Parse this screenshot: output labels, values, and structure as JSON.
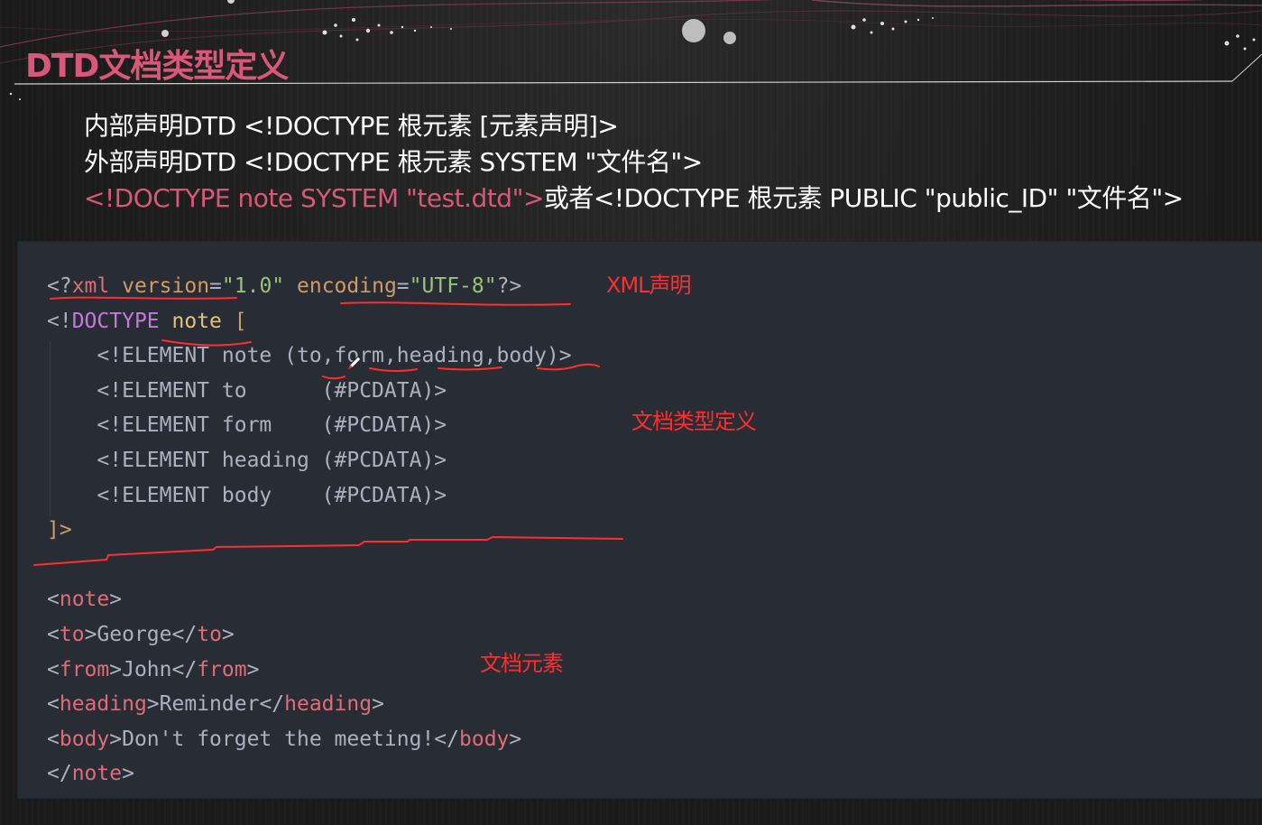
{
  "slide": {
    "title": "DTD文档类型定义"
  },
  "syntax": {
    "internal": "内部声明DTD  <!DOCTYPE 根元素 [元素声明]>",
    "external": "外部声明DTD  <!DOCTYPE 根元素 SYSTEM \"文件名\">",
    "example_pink": "<!DOCTYPE note SYSTEM \"test.dtd\">",
    "or_text": "或者<!DOCTYPE 根元素 PUBLIC \"public_ID\" \"文件名\">"
  },
  "code": {
    "xml_decl": {
      "open": "<?",
      "xml": "xml",
      "version_attr": "version",
      "eq": "=",
      "version_val": "\"1.0\"",
      "encoding_attr": "encoding",
      "encoding_val": "\"UTF-8\"",
      "close": "?>"
    },
    "doctype": {
      "open": "<!",
      "keyword": "DOCTYPE",
      "name": "note",
      "bracket": "["
    },
    "elements": [
      {
        "decl": "<!ELEMENT",
        "name": "note",
        "pad": "    ",
        "content": "(to,form,heading,body)>"
      },
      {
        "decl": "<!ELEMENT",
        "name": "to",
        "pad": "      ",
        "content": "(#PCDATA)>"
      },
      {
        "decl": "<!ELEMENT",
        "name": "form",
        "pad": "    ",
        "content": "(#PCDATA)>"
      },
      {
        "decl": "<!ELEMENT",
        "name": "heading",
        "pad": " ",
        "content": "(#PCDATA)>"
      },
      {
        "decl": "<!ELEMENT",
        "name": "body",
        "pad": "    ",
        "content": "(#PCDATA)>"
      }
    ],
    "doctype_close": "]>",
    "doc": {
      "note": "note",
      "to_tag": "to",
      "to_text": "George",
      "from_tag": "from",
      "from_text": "John",
      "heading_tag": "heading",
      "heading_text": "Reminder",
      "body_tag": "body",
      "body_text": "Don't forget the meeting!"
    }
  },
  "annotations": {
    "xml_decl": "XML声明",
    "dtd": "文档类型定义",
    "elements": "文档元素",
    "color": "#ff2e2e"
  },
  "cursor_icon": "pen-cursor-icon"
}
